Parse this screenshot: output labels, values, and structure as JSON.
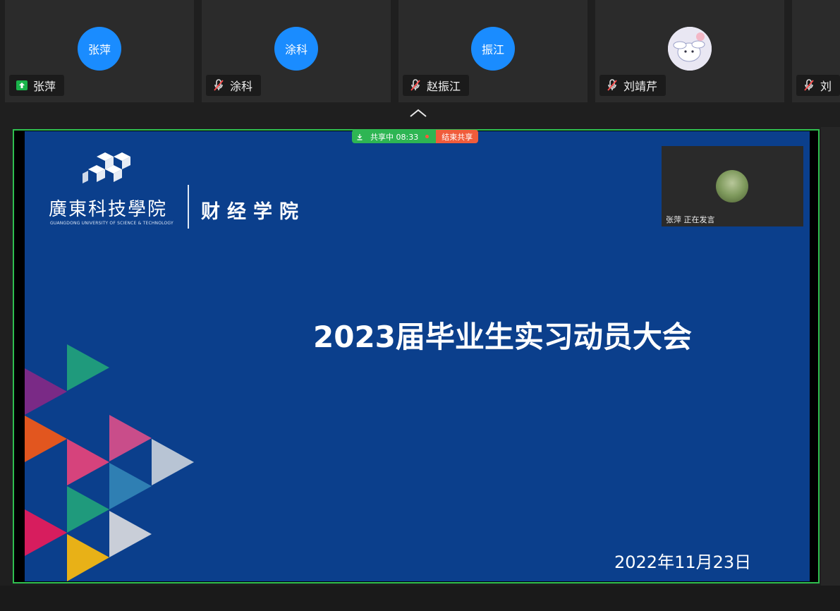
{
  "participants": [
    {
      "avatar_text": "张萍",
      "name": "张萍",
      "status_icon": "screen-share-icon"
    },
    {
      "avatar_text": "涂科",
      "name": "涂科",
      "status_icon": "mic-muted-icon"
    },
    {
      "avatar_text": "振江",
      "name": "赵振江",
      "status_icon": "mic-muted-icon"
    },
    {
      "avatar_text": "",
      "name": "刘靖芹",
      "status_icon": "mic-muted-icon"
    },
    {
      "avatar_text": "",
      "name": "刘",
      "status_icon": "mic-muted-icon"
    }
  ],
  "share_toolbar": {
    "sharing_label": "共享中 08:33",
    "stop_label": "结束共享"
  },
  "slide": {
    "school_name": "廣東科技學院",
    "school_english": "GUANGDONG UNIVERSITY OF SCIENCE & TECHNOLOGY",
    "department": "财经学院",
    "title": "2023届毕业生实习动员大会",
    "date": "2022年11月23日"
  },
  "speaker": {
    "label": "张萍 正在发言"
  },
  "colors": {
    "avatar_blue": "#1a8cff",
    "share_border": "#2fbf4f",
    "slide_bg": "#0b3f8c",
    "stop_red": "#f05c3b"
  }
}
